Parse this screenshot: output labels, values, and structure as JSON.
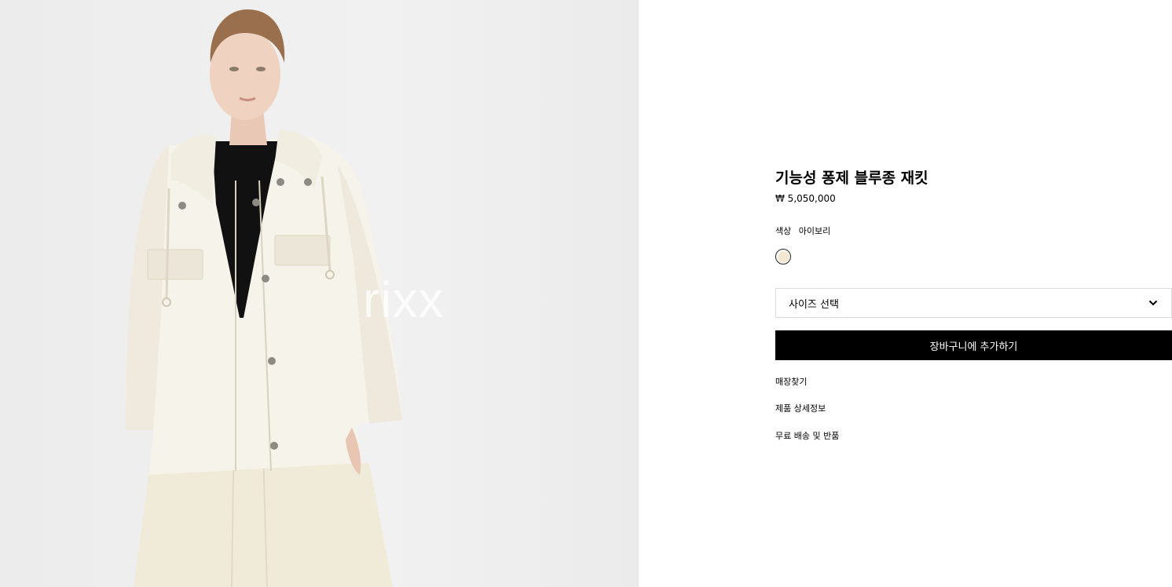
{
  "product": {
    "title": "기능성 퐁제 블루종 재킷",
    "price": "₩ 5,050,000",
    "color_label": "색상",
    "color_value": "아이보리",
    "swatch_color": "#f3e7d2",
    "image_watermark": "rixx"
  },
  "size_select": {
    "value": "사이즈 선택",
    "icon": "chevron-down-icon"
  },
  "actions": {
    "add_to_cart": "장바구니에 추가하기"
  },
  "links": {
    "find_store": "매장찾기",
    "product_details": "제품 상세정보",
    "shipping_returns": "무료 배송 및 반품"
  }
}
